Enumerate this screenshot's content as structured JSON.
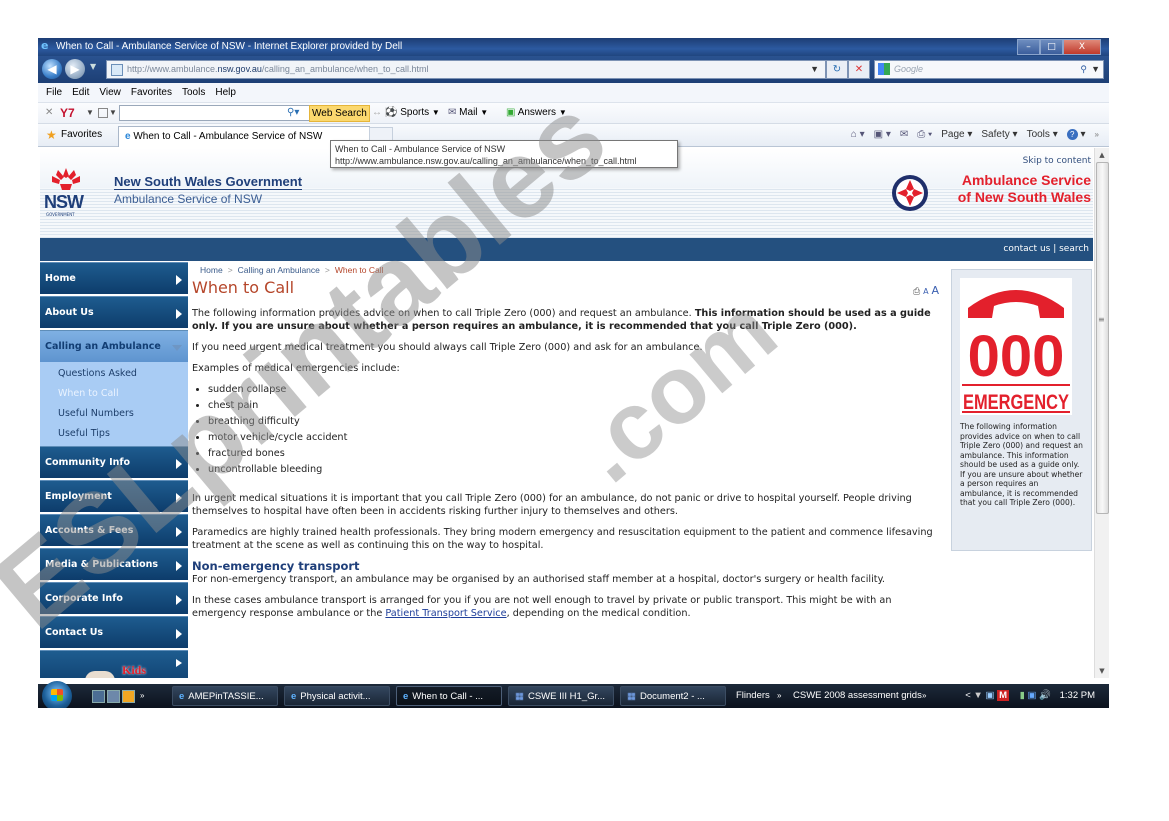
{
  "window": {
    "title": "When to Call - Ambulance Service of NSW - Internet Explorer provided by Dell",
    "controls": {
      "minimize": "–",
      "maximize": "□",
      "close": "X"
    }
  },
  "addressbar": {
    "url_prefix": "http://www.ambulance.",
    "url_domain": "nsw.gov.au",
    "url_path": "/calling_an_ambulance/when_to_call.html",
    "search_placeholder": "Google"
  },
  "menubar": [
    "File",
    "Edit",
    "View",
    "Favorites",
    "Tools",
    "Help"
  ],
  "yahoo_toolbar": {
    "logo": "Y7",
    "search_value": "",
    "web_search_label": "Web Search",
    "items": [
      "Sports",
      "Mail",
      "Answers"
    ]
  },
  "favorites_bar": {
    "favorites_label": "Favorites",
    "tab_title": "When to Call - Ambulance Service of NSW",
    "commands": [
      "Page",
      "Safety",
      "Tools"
    ]
  },
  "tooltip": {
    "line1": "When to Call - Ambulance Service of NSW",
    "line2": "http://www.ambulance.nsw.gov.au/calling_an_ambulance/when_to_call.html"
  },
  "site": {
    "gov_name": "New South Wales Government",
    "service_name": "Ambulance Service of NSW",
    "nsw_logo_text": "NSW",
    "nsw_logo_sub": "GOVERNMENT",
    "skip_link": "Skip to content",
    "brand_line1": "Ambulance Service",
    "brand_line2": "of New South Wales",
    "top_links": "contact us | search",
    "brand_color": "#e3202c",
    "nav_color": "#24507f"
  },
  "sidebar": {
    "items": [
      {
        "label": "Home"
      },
      {
        "label": "About Us"
      },
      {
        "label": "Calling an Ambulance",
        "active": true
      },
      {
        "label": "Community Info"
      },
      {
        "label": "Employment"
      },
      {
        "label": "Accounts & Fees"
      },
      {
        "label": "Media & Publications"
      },
      {
        "label": "Corporate Info"
      },
      {
        "label": "Contact Us"
      }
    ],
    "subitems": [
      "Questions Asked",
      "When to Call",
      "Useful Numbers",
      "Useful Tips"
    ],
    "current_subitem": "When to Call",
    "kids_label": "Kids"
  },
  "content": {
    "breadcrumb": [
      "Home",
      "Calling an Ambulance",
      "When to Call"
    ],
    "title": "When to Call",
    "text_size_small": "A",
    "text_size_large": "A",
    "intro_normal": "The following information provides advice on when to call Triple Zero (000) and request an ambulance. ",
    "intro_bold": "This information should be used as a guide only. If you are unsure about whether a person requires an ambulance, it is recommended that you call Triple Zero (000).",
    "p_urgent": "If you need urgent medical treatment you should always call Triple Zero (000) and ask for an ambulance.",
    "p_examples": "Examples of medical emergencies include:",
    "emergencies": [
      "sudden collapse",
      "chest pain",
      "breathing difficulty",
      "motor vehicle/cycle accident",
      "fractured bones",
      "uncontrollable bleeding"
    ],
    "p_situations": "In urgent medical situations it is important that you call Triple Zero (000) for an ambulance, do not panic or drive to hospital yourself. People driving themselves to hospital have often been in accidents risking further injury to themselves and others.",
    "p_paramedics": "Paramedics are highly trained health professionals. They bring modern emergency and resuscitation equipment to the patient and commence lifesaving treatment at the scene as well as continuing this on the way to hospital.",
    "h_nonemergency": "Non-emergency transport",
    "p_nonemergency": "For non-emergency transport, an ambulance may be organised by an authorised staff member at a hospital, doctor's surgery or health facility.",
    "p_cases_before": "In these cases ambulance transport is arranged for you if you are not well enough to travel by private or public transport. This might be with an emergency response ambulance or the ",
    "p_cases_link": "Patient Transport Service",
    "p_cases_after": ", depending on the medical condition."
  },
  "sidebox": {
    "big_number": "000",
    "emergency_label": "EMERGENCY",
    "text": "The following information provides advice on when to call Triple Zero (000) and request an ambulance. This information should be used as a guide only. If you are unsure about whether a person requires an ambulance, it is recommended that you call Triple Zero (000)."
  },
  "taskbar": {
    "buttons": [
      {
        "label": "AMEPinTASSIE...",
        "icon": "ie"
      },
      {
        "label": "Physical activit...",
        "icon": "ie"
      },
      {
        "label": "When to Call - ...",
        "icon": "ie",
        "active": true
      },
      {
        "label": "CSWE III H1_Gr...",
        "icon": "word"
      },
      {
        "label": "Document2 - ...",
        "icon": "word"
      }
    ],
    "toolbar_links": [
      "Flinders",
      "CSWE 2008 assessment grids"
    ],
    "clock": "1:32 PM"
  },
  "watermark": {
    "text_main": "ESLprintables",
    "text_tail": ".com"
  }
}
